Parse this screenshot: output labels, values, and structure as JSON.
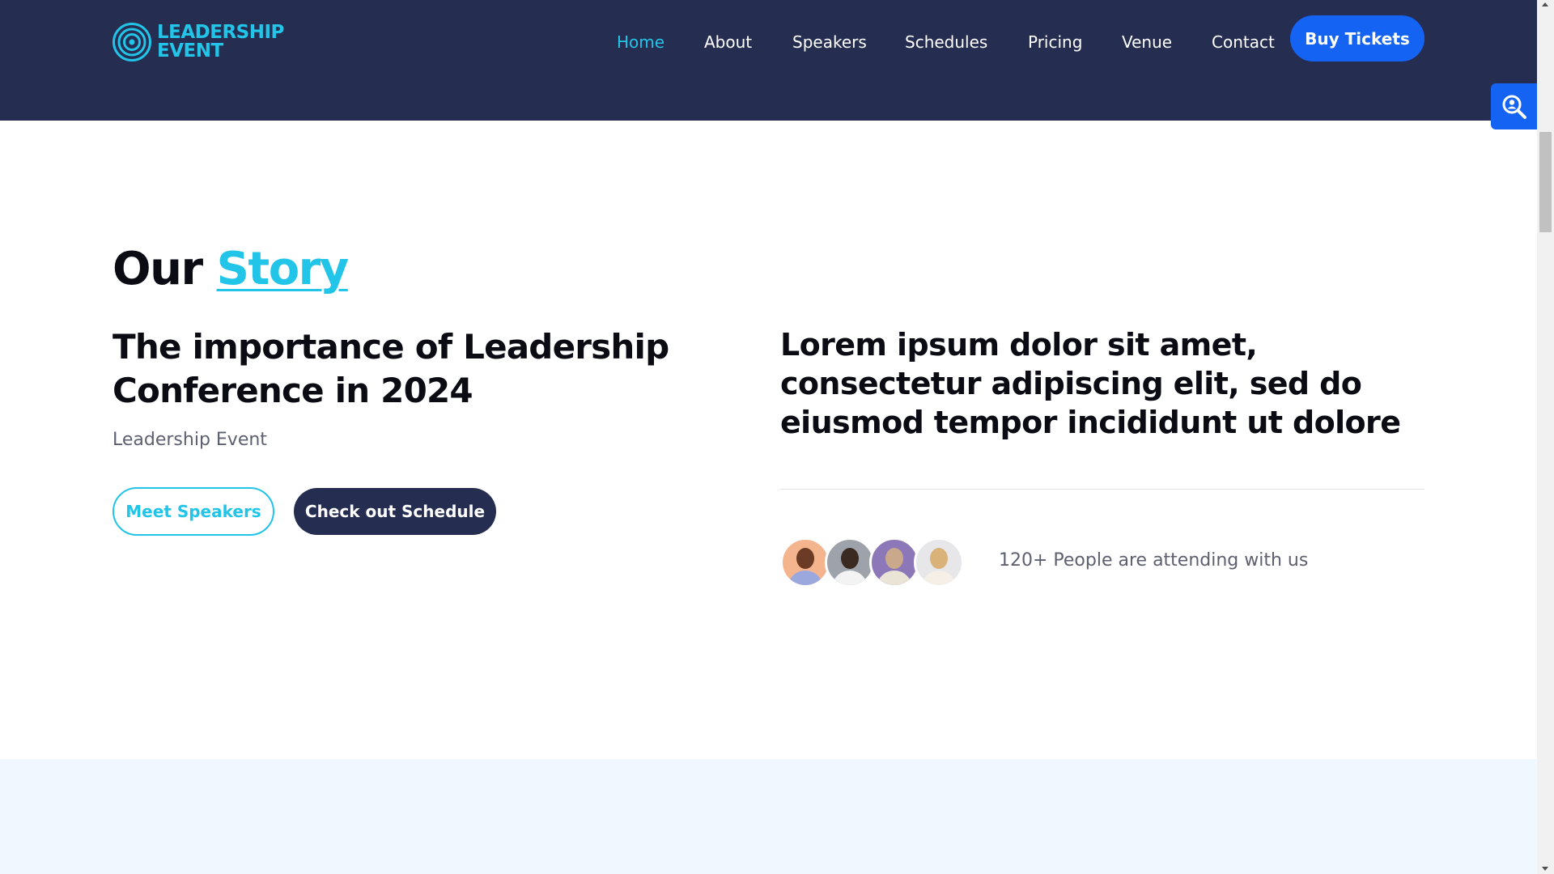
{
  "header": {
    "logo": {
      "line1": "LEADERSHIP",
      "line2": "EVENT"
    },
    "nav": [
      {
        "label": "Home",
        "active": true
      },
      {
        "label": "About",
        "active": false
      },
      {
        "label": "Speakers",
        "active": false
      },
      {
        "label": "Schedules",
        "active": false
      },
      {
        "label": "Pricing",
        "active": false
      },
      {
        "label": "Venue",
        "active": false
      },
      {
        "label": "Contact",
        "active": false
      }
    ],
    "cta_label": "Buy Tickets"
  },
  "side_widget": {
    "icon": "magnifier-user-icon"
  },
  "story": {
    "title_plain": "Our",
    "title_accent": "Story",
    "heading": "The importance of Leadership Conference in 2024",
    "subtitle": "Leadership Event",
    "buttons": {
      "meet_speakers": "Meet Speakers",
      "check_schedule": "Check out Schedule"
    },
    "lead": "Lorem ipsum dolor sit amet, consectetur adipiscing elit, sed do eiusmod tempor incididunt ut dolore",
    "attending_text": "120+ People are attending with us"
  },
  "colors": {
    "navy": "#252d50",
    "accent": "#22c4e8",
    "primary_blue": "#1463f3",
    "muted_text": "#5d6070",
    "light_band": "#f1f7ff"
  }
}
